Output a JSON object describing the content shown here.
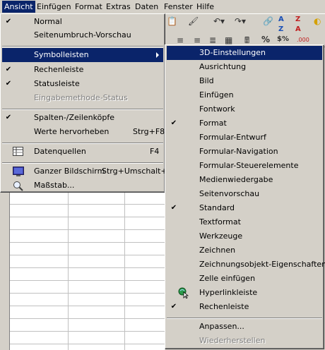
{
  "menubar": {
    "items": [
      {
        "label": "Ansicht",
        "active": true
      },
      {
        "label": "Einfügen"
      },
      {
        "label": "Format"
      },
      {
        "label": "Extras"
      },
      {
        "label": "Daten"
      },
      {
        "label": "Fenster"
      },
      {
        "label": "Hilfe"
      }
    ]
  },
  "toolbar": {
    "sort_asc_icon": "sort-ascending-icon",
    "sort_desc_icon": "sort-descending-icon",
    "percent_label": "%",
    "currency_label": "$%",
    "decimal_label": ".000"
  },
  "ansicht_menu": {
    "items": [
      {
        "label": "Normal",
        "checked": true
      },
      {
        "label": "Seitenumbruch-Vorschau"
      },
      {
        "label": "Symbolleisten",
        "submenu": true,
        "highlighted": true
      },
      {
        "label": "Rechenleiste",
        "checked": true
      },
      {
        "label": "Statusleiste",
        "checked": true
      },
      {
        "label": "Eingabemethode-Status",
        "disabled": true
      },
      {
        "label": "Spalten-/Zeilenköpfe",
        "checked": true
      },
      {
        "label": "Werte hervorheben",
        "shortcut": "Strg+F8"
      },
      {
        "label": "Datenquellen",
        "shortcut": "F4",
        "icon": "data-sources-icon"
      },
      {
        "label": "Ganzer Bildschirm",
        "shortcut": "Strg+Umschalt+J",
        "icon": "fullscreen-icon"
      },
      {
        "label": "Maßstab...",
        "icon": "magnifier-icon"
      }
    ]
  },
  "symbolleisten_menu": {
    "items": [
      {
        "label": "3D-Einstellungen",
        "highlighted": true
      },
      {
        "label": "Ausrichtung"
      },
      {
        "label": "Bild"
      },
      {
        "label": "Einfügen"
      },
      {
        "label": "Fontwork"
      },
      {
        "label": "Format",
        "checked": true
      },
      {
        "label": "Formular-Entwurf"
      },
      {
        "label": "Formular-Navigation"
      },
      {
        "label": "Formular-Steuerelemente"
      },
      {
        "label": "Medienwiedergabe"
      },
      {
        "label": "Seitenvorschau"
      },
      {
        "label": "Standard",
        "checked": true
      },
      {
        "label": "Textformat"
      },
      {
        "label": "Werkzeuge"
      },
      {
        "label": "Zeichnen"
      },
      {
        "label": "Zeichnungsobjekt-Eigenschaften"
      },
      {
        "label": "Zelle einfügen"
      },
      {
        "label": "Hyperlinkleiste",
        "icon": "hyperlink-bar-icon"
      },
      {
        "label": "Rechenleiste",
        "checked": true
      },
      {
        "label": "Anpassen..."
      },
      {
        "label": "Wiederherstellen",
        "disabled": true
      }
    ]
  },
  "colors": {
    "highlight": "#0a246a",
    "menu_bg": "#d4d0c8",
    "disabled_text": "#808080"
  }
}
